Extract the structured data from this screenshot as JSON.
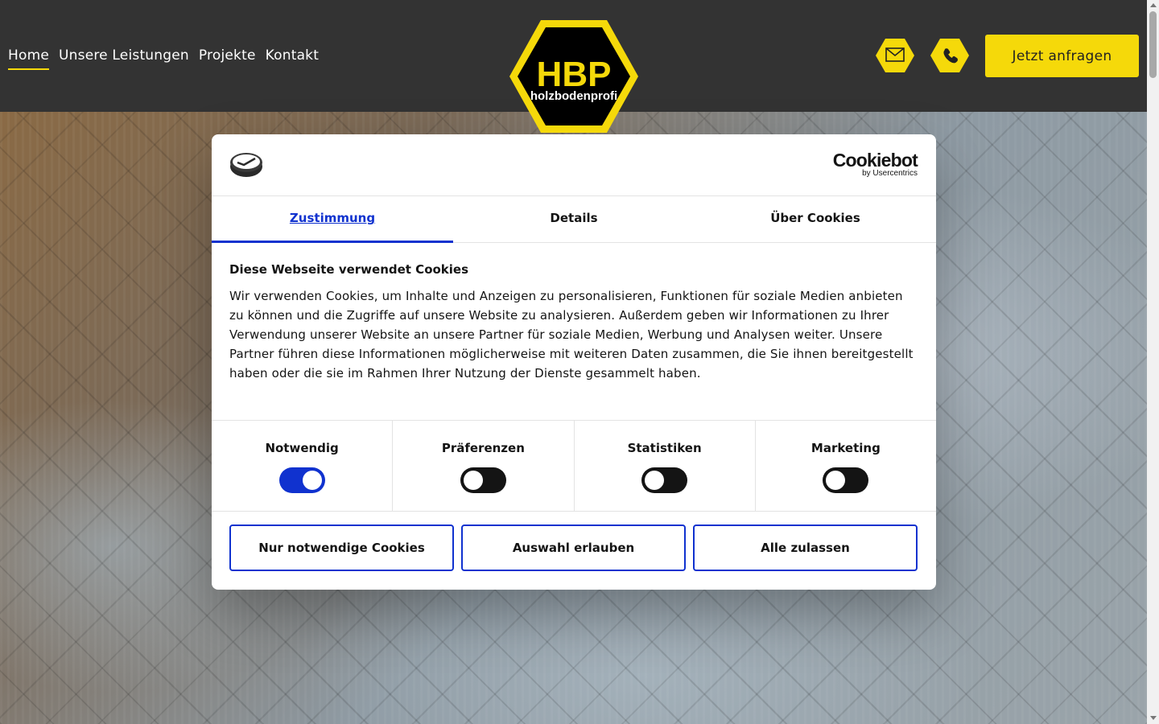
{
  "nav": {
    "items": [
      {
        "label": "Home",
        "active": true
      },
      {
        "label": "Unsere Leistungen",
        "active": false
      },
      {
        "label": "Projekte",
        "active": false
      },
      {
        "label": "Kontakt",
        "active": false
      }
    ]
  },
  "logo": {
    "letters": "HBP",
    "subtitle": "holzbodenprofi"
  },
  "header": {
    "cta_label": "Jetzt anfragen",
    "mail_icon": "envelope-icon",
    "phone_icon": "phone-icon"
  },
  "colors": {
    "brand_yellow": "#f5d90a",
    "header_bg": "#333333",
    "accent_blue": "#1032cf"
  },
  "cookie": {
    "brand_name": "Cookiebot",
    "brand_by": "by Usercentrics",
    "tabs": [
      {
        "label": "Zustimmung",
        "active": true
      },
      {
        "label": "Details",
        "active": false
      },
      {
        "label": "Über Cookies",
        "active": false
      }
    ],
    "heading": "Diese Webseite verwendet Cookies",
    "text": "Wir verwenden Cookies, um Inhalte und Anzeigen zu personalisieren, Funktionen für soziale Medien anbieten zu können und die Zugriffe auf unsere Website zu analysieren. Außerdem geben wir Informationen zu Ihrer Verwendung unserer Website an unsere Partner für soziale Medien, Werbung und Analysen weiter. Unsere Partner führen diese Informationen möglicherweise mit weiteren Daten zusammen, die Sie ihnen bereitgestellt haben oder die sie im Rahmen Ihrer Nutzung der Dienste gesammelt haben.",
    "toggles": [
      {
        "label": "Notwendig",
        "on": true
      },
      {
        "label": "Präferenzen",
        "on": false
      },
      {
        "label": "Statistiken",
        "on": false
      },
      {
        "label": "Marketing",
        "on": false
      }
    ],
    "buttons": {
      "necessary": "Nur notwendige Cookies",
      "selection": "Auswahl erlauben",
      "all": "Alle zulassen"
    }
  }
}
